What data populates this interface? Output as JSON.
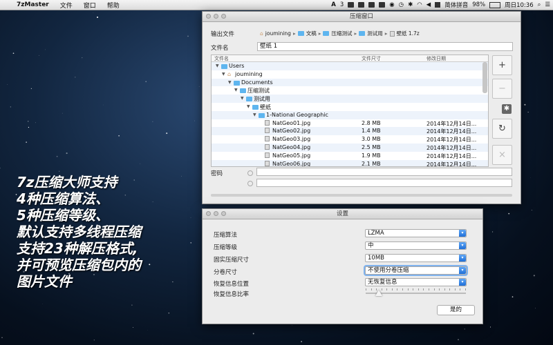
{
  "menubar": {
    "app": "7zMaster",
    "menus": [
      "文件",
      "窗口",
      "帮助"
    ],
    "status": {
      "adobe": "3",
      "input_method": "简体拼音",
      "battery": "98%",
      "clock": "周日10:36"
    }
  },
  "promo_lines": [
    "7z压缩大师支持",
    "4种压缩算法、",
    "5种压缩等级、",
    "默认支持多线程压缩",
    "支持23种解压格式,",
    "并可预览压缩包内的",
    "图片文件"
  ],
  "compress_window": {
    "title": "压缩窗口",
    "output_label": "输出文件",
    "path": [
      "joumining",
      "文稿",
      "压缩测试",
      "测试用",
      "壁纸 1.7z"
    ],
    "filename_label": "文件名",
    "filename_value": "壁纸 1",
    "columns": {
      "name": "文件名",
      "size": "文件尺寸",
      "date": "修改日期"
    },
    "tree": [
      {
        "name": "Users",
        "size": "",
        "date": "",
        "type": "folder",
        "level": 0
      },
      {
        "name": "joumining",
        "size": "",
        "date": "",
        "type": "home",
        "level": 1
      },
      {
        "name": "Documents",
        "size": "",
        "date": "",
        "type": "folder",
        "level": 2
      },
      {
        "name": "压缩测试",
        "size": "",
        "date": "",
        "type": "folder",
        "level": 3
      },
      {
        "name": "测试用",
        "size": "",
        "date": "",
        "type": "folder",
        "level": 4
      },
      {
        "name": "壁纸",
        "size": "",
        "date": "",
        "type": "folder",
        "level": 5
      },
      {
        "name": "1-National Geographic",
        "size": "",
        "date": "",
        "type": "folder",
        "level": 6
      },
      {
        "name": "NatGeo01.jpg",
        "size": "2.8 MB",
        "date": "2014年12月14日...",
        "type": "file",
        "level": 7
      },
      {
        "name": "NatGeo02.jpg",
        "size": "1.4 MB",
        "date": "2014年12月14日...",
        "type": "file",
        "level": 7
      },
      {
        "name": "NatGeo03.jpg",
        "size": "3.0 MB",
        "date": "2014年12月14日...",
        "type": "file",
        "level": 7
      },
      {
        "name": "NatGeo04.jpg",
        "size": "2.5 MB",
        "date": "2014年12月14日...",
        "type": "file",
        "level": 7
      },
      {
        "name": "NatGeo05.jpg",
        "size": "1.9 MB",
        "date": "2014年12月14日...",
        "type": "file",
        "level": 7
      },
      {
        "name": "NatGeo06.jpg",
        "size": "2.1 MB",
        "date": "2014年12月14日...",
        "type": "file",
        "level": 7
      }
    ],
    "side_buttons": {
      "add": "+",
      "remove": "−",
      "refresh": "↻",
      "clear": "×"
    },
    "password_label": "密码"
  },
  "settings_window": {
    "title": "设置",
    "rows": [
      {
        "label": "压缩算法",
        "value": "LZMA"
      },
      {
        "label": "压缩等级",
        "value": "中"
      },
      {
        "label": "固实压缩尺寸",
        "value": "10MB"
      },
      {
        "label": "分卷尺寸",
        "value": "不使用分卷压缩"
      },
      {
        "label": "恢复信息位置",
        "value": "无恢复信息"
      },
      {
        "label": "恢复信息比率",
        "value": ""
      }
    ],
    "ok_label": "是的"
  }
}
